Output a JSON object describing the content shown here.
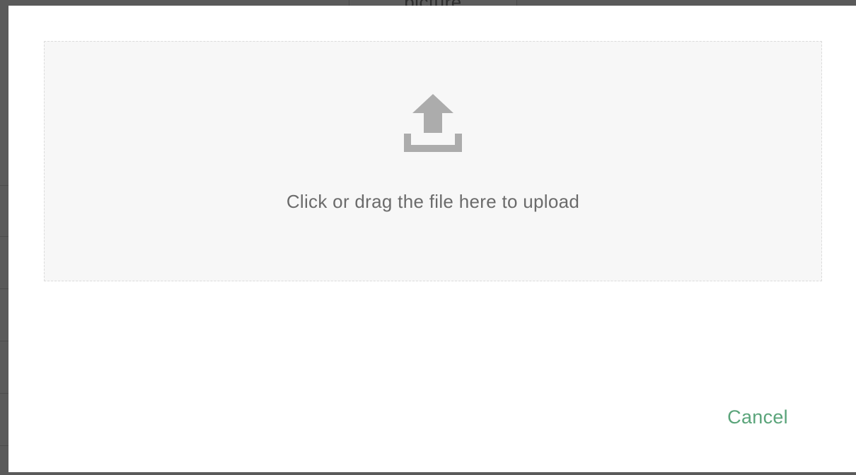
{
  "background": {
    "cell_text": "picture"
  },
  "upload_dialog": {
    "dropzone_text": "Click or drag the file here to upload",
    "upload_icon": "upload-icon",
    "cancel_label": "Cancel"
  },
  "colors": {
    "accent": "#5aa47a",
    "dropzone_bg": "#f7f7f7",
    "icon": "#acacac",
    "text": "#6b6b6b"
  }
}
